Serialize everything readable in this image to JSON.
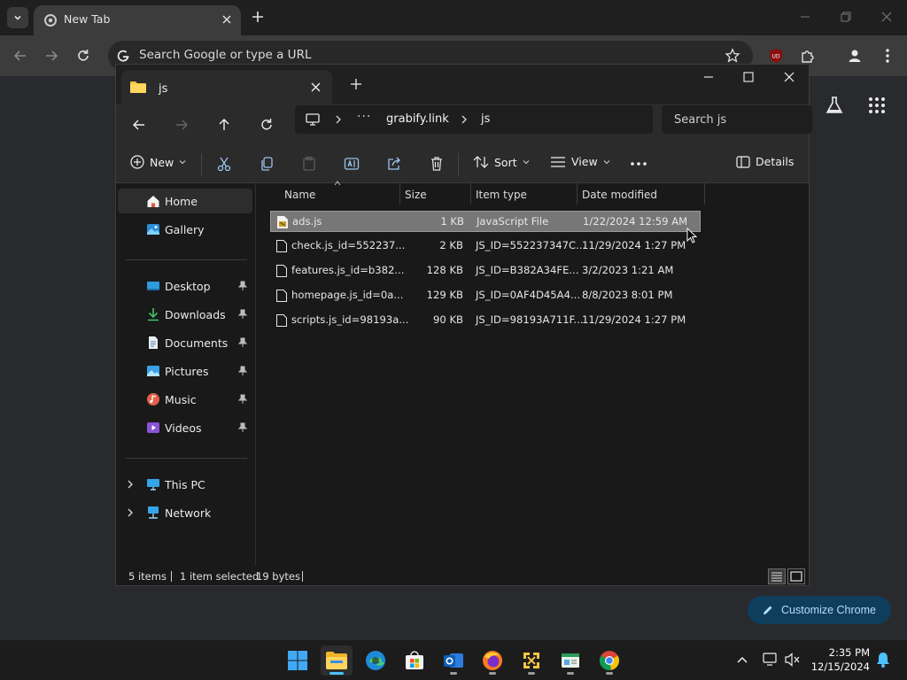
{
  "chrome": {
    "tab_title": "New Tab",
    "omnibox_placeholder": "Search Google or type a URL",
    "customize_label": "Customize Chrome"
  },
  "explorer": {
    "tab_title": "js",
    "breadcrumb": [
      "grabify.link",
      "js"
    ],
    "search_placeholder": "Search js",
    "commands": {
      "new": "New",
      "sort": "Sort",
      "view": "View",
      "details": "Details"
    },
    "sidebar": {
      "home": "Home",
      "gallery": "Gallery",
      "quick_access": [
        "Desktop",
        "Downloads",
        "Documents",
        "Pictures",
        "Music",
        "Videos"
      ],
      "this_pc": "This PC",
      "network": "Network"
    },
    "columns": {
      "name": "Name",
      "size": "Size",
      "type": "Item type",
      "date": "Date modified"
    },
    "files": [
      {
        "name": "ads.js",
        "size": "1 KB",
        "type": "JavaScript File",
        "date": "1/22/2024 12:59 AM",
        "selected": true
      },
      {
        "name": "check.js_id=552237...",
        "size": "2 KB",
        "type": "JS_ID=552237347C...",
        "date": "11/29/2024 1:27 PM",
        "selected": false
      },
      {
        "name": "features.js_id=b382...",
        "size": "128 KB",
        "type": "JS_ID=B382A34FE...",
        "date": "3/2/2023 1:21 AM",
        "selected": false
      },
      {
        "name": "homepage.js_id=0a...",
        "size": "129 KB",
        "type": "JS_ID=0AF4D45A4...",
        "date": "8/8/2023 8:01 PM",
        "selected": false
      },
      {
        "name": "scripts.js_id=98193a...",
        "size": "90 KB",
        "type": "JS_ID=98193A711F...",
        "date": "11/29/2024 1:27 PM",
        "selected": false
      }
    ],
    "status": {
      "items": "5 items",
      "selected": "1 item selected",
      "bytes": "19 bytes"
    }
  },
  "taskbar": {
    "time": "2:35 PM",
    "date": "12/15/2024"
  },
  "colors": {
    "accent": "#4cc2ff",
    "selection": "#777777",
    "folder_yellow": "#f4c542"
  }
}
